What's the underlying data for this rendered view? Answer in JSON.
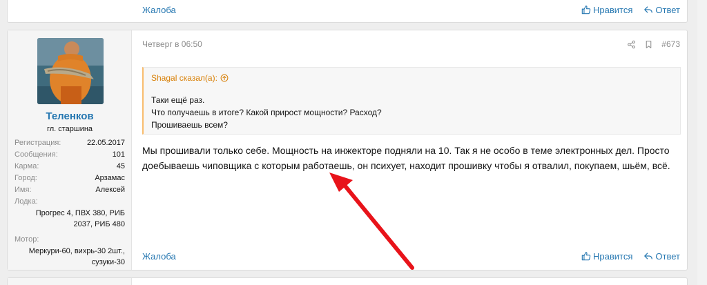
{
  "prev_post": {
    "report_label": "Жалоба",
    "like_label": "Нравится",
    "reply_label": "Ответ"
  },
  "post": {
    "timestamp": "Четверг в 06:50",
    "post_number": "#673",
    "user": {
      "name": "Теленков",
      "title": "гл. старшина",
      "stats": [
        {
          "key": "Регистрация:",
          "value": "22.05.2017"
        },
        {
          "key": "Сообщения:",
          "value": "101"
        },
        {
          "key": "Карма:",
          "value": "45"
        },
        {
          "key": "Город:",
          "value": "Арзамас"
        },
        {
          "key": "Имя:",
          "value": "Алексей"
        }
      ],
      "boat_label": "Лодка:",
      "boat_value": "Прогрес 4, ПВХ 380, РИБ 2037, РИБ 480",
      "motor_label": "Мотор:",
      "motor_value": "Меркури-60, вихрь-30 2шт., сузуки-30"
    },
    "quote": {
      "author": "Shagal сказал(а):",
      "lines": [
        "Таки ещё раз.",
        "Что получаешь в итоге? Какой прирост мощности? Расход?",
        "Прошиваешь всем?"
      ]
    },
    "message": "Мы прошивали только себе. Мощность на инжекторе подняли на 10. Так я не особо в теме электронных дел. Просто доебываешь чиповщика с которым работаешь, он психует, находит прошивку чтобы я отвалил, покупаем, шьём, всё.",
    "report_label": "Жалоба",
    "like_label": "Нравится",
    "reply_label": "Ответ"
  },
  "colors": {
    "link": "#2577b1",
    "quote_accent": "#d87f05",
    "annotation_arrow": "#e8131a"
  },
  "icons": [
    "thumbs-up-icon",
    "reply-icon",
    "share-icon",
    "bookmark-icon",
    "arrow-up-circle-icon"
  ]
}
